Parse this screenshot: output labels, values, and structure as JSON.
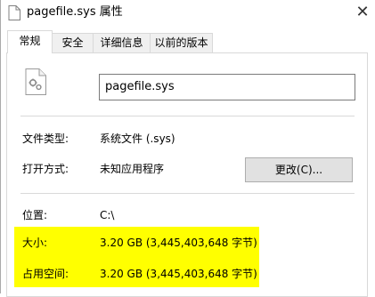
{
  "window": {
    "title": "pagefile.sys 属性",
    "close_glyph": "✕"
  },
  "tabs": [
    {
      "label": "常规",
      "active": true
    },
    {
      "label": "安全",
      "active": false
    },
    {
      "label": "详细信息",
      "active": false
    },
    {
      "label": "以前的版本",
      "active": false
    }
  ],
  "general": {
    "file_name": "pagefile.sys",
    "file_type_label": "文件类型:",
    "file_type_value": "系统文件 (.sys)",
    "opens_with_label": "打开方式:",
    "opens_with_value": "未知应用程序",
    "change_button": "更改(C)...",
    "location_label": "位置:",
    "location_value": "C:\\",
    "size_label": "大小:",
    "size_value": "3.20 GB (3,445,403,648 字节)",
    "size_on_disk_label": "占用空间:",
    "size_on_disk_value": "3.20 GB (3,445,403,648 字节)"
  },
  "icons": {
    "title_icon": "document-icon",
    "file_icon": "system-file-icon"
  },
  "colors": {
    "highlight": "#ffff00",
    "button_bg": "#e1e1e1"
  }
}
